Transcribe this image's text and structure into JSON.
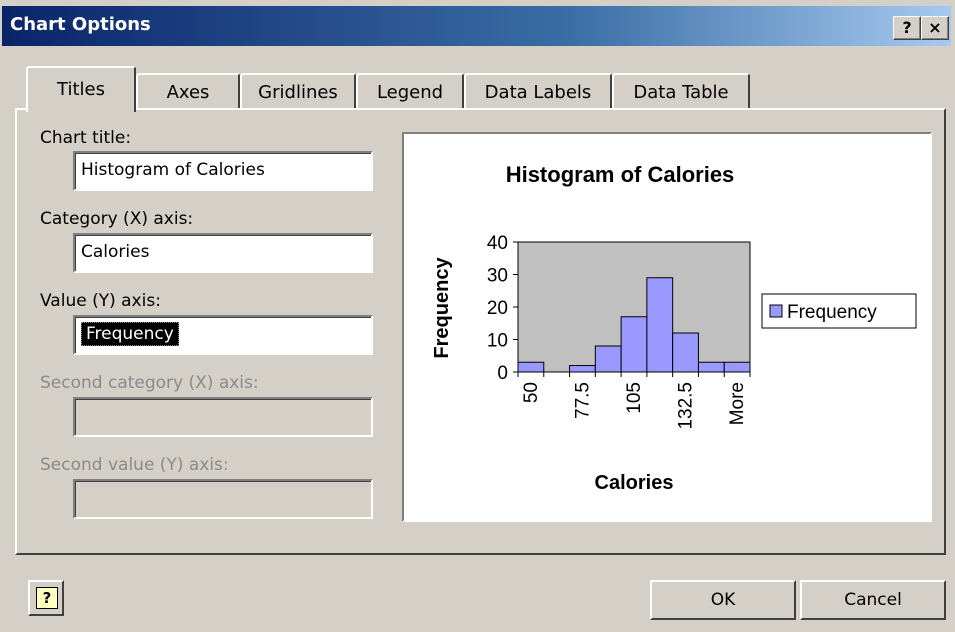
{
  "window": {
    "title": "Chart Options",
    "help_glyph": "?",
    "close_glyph": "×"
  },
  "tabs": [
    {
      "label": "Titles",
      "active": true
    },
    {
      "label": "Axes"
    },
    {
      "label": "Gridlines"
    },
    {
      "label": "Legend"
    },
    {
      "label": "Data Labels"
    },
    {
      "label": "Data Table"
    }
  ],
  "form": {
    "chart_title_label": "Chart title:",
    "chart_title_value": "Histogram of Calories",
    "category_x_label": "Category (X) axis:",
    "category_x_value": "Calories",
    "value_y_label": "Value (Y) axis:",
    "value_y_value": "Frequency",
    "second_category_label": "Second category (X) axis:",
    "second_value_label": "Second value (Y) axis:"
  },
  "chart_data": {
    "type": "bar",
    "title": "Histogram of Calories",
    "xlabel": "Calories",
    "ylabel": "Frequency",
    "categories": [
      "50",
      "",
      "77.5",
      "",
      "105",
      "",
      "132.5",
      "",
      "More"
    ],
    "tick_labels": [
      "50",
      "77.5",
      "105",
      "132.5",
      "More"
    ],
    "series": [
      {
        "name": "Frequency",
        "values": [
          3,
          0,
          2,
          8,
          17,
          29,
          12,
          3,
          3
        ]
      }
    ],
    "ylim": [
      0,
      40
    ],
    "yticks": [
      0,
      10,
      20,
      30,
      40
    ],
    "grid": false,
    "plot_background": "#c0c0c0",
    "bar_color": "#9999ff",
    "legend": "right"
  },
  "buttons": {
    "ok": "OK",
    "cancel": "Cancel",
    "help_glyph": "?"
  }
}
